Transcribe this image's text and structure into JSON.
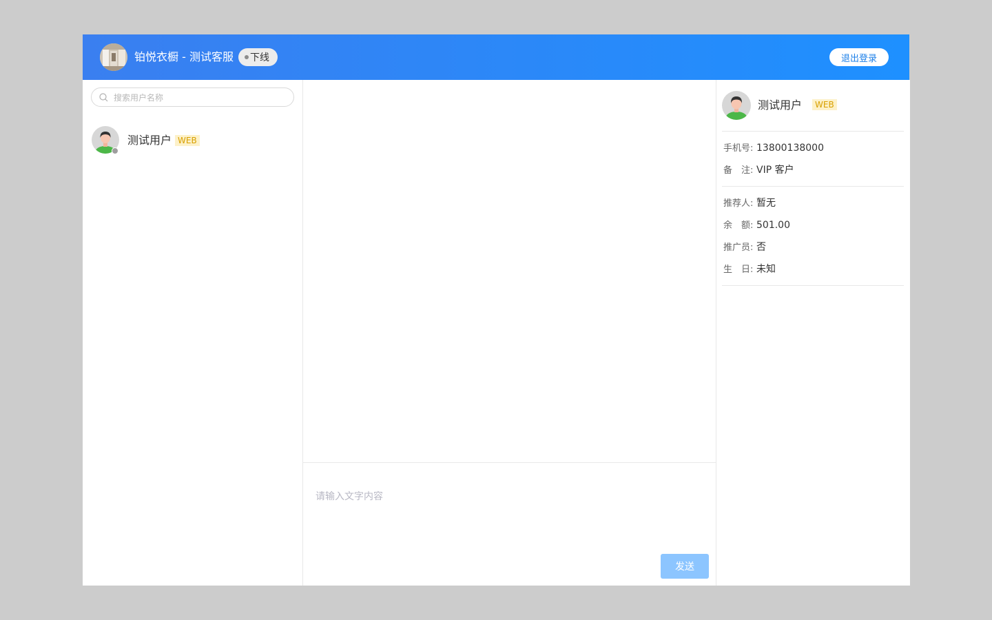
{
  "header": {
    "title": "铂悦衣橱 - 测试客服",
    "status": "下线",
    "logout_label": "退出登录"
  },
  "search": {
    "placeholder": "搜索用户名称"
  },
  "contacts": [
    {
      "name": "测试用户",
      "tag": "WEB",
      "online": false
    }
  ],
  "composer": {
    "placeholder": "请输入文字内容",
    "send_label": "发送"
  },
  "profile": {
    "name": "测试用户",
    "tag": "WEB",
    "fields": [
      {
        "label": "手机号:",
        "value": "13800138000"
      },
      {
        "label": "备　注:",
        "value": "VIP 客户"
      }
    ],
    "extra": [
      {
        "label": "推荐人:",
        "value": "暂无"
      },
      {
        "label": "余　额:",
        "value": "501.00"
      },
      {
        "label": "推广员:",
        "value": "否"
      },
      {
        "label": "生　日:",
        "value": "未知"
      }
    ]
  },
  "colors": {
    "header_start": "#3a7ff0",
    "header_end": "#1e90ff",
    "send_button": "#8cc5ff",
    "tag_bg": "#fdf1c9",
    "tag_text": "#d8a000"
  }
}
